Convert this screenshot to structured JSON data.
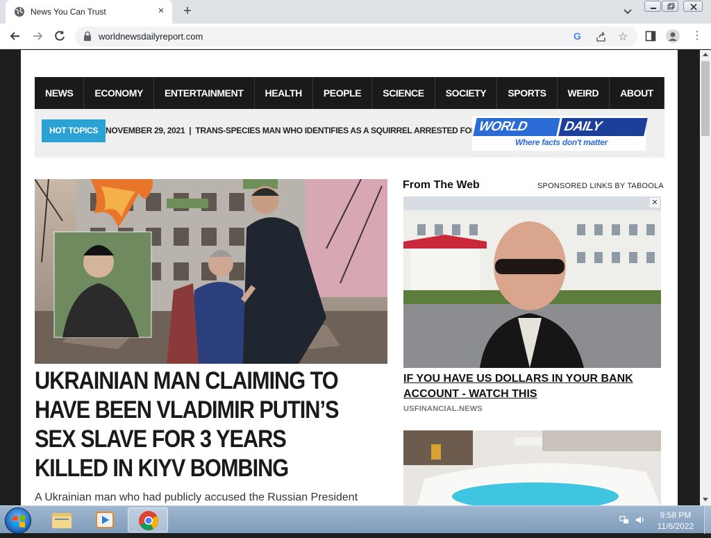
{
  "browser": {
    "tab_title": "News You Can Trust",
    "tab_close": "×",
    "new_tab": "+",
    "url": "worldnewsdailyreport.com",
    "menu_glyph": "⋮",
    "star_glyph": "☆",
    "google_glyph": "G"
  },
  "nav": {
    "items": [
      "NEWS",
      "ECONOMY",
      "ENTERTAINMENT",
      "HEALTH",
      "PEOPLE",
      "SCIENCE",
      "SOCIETY",
      "SPORTS",
      "WEIRD",
      "ABOUT US"
    ]
  },
  "hot_topics": {
    "label": "HOT TOPICS",
    "date": "NOVEMBER 29, 2021",
    "separator": "|",
    "headline": "TRANS-SPECIES MAN WHO IDENTIFIES AS A SQUIRREL ARRESTED FOR"
  },
  "logo": {
    "part1": "WORLD NEWS",
    "part2": "DAILY REPORT",
    "tagline": "Where facts don't matter"
  },
  "article": {
    "headline": "UKRAINIAN MAN CLAIMING TO HAVE BEEN VLADIMIR PUTIN’S SEX SLAVE FOR 3 YEARS KILLED IN KIYV BOMBING",
    "excerpt": "A Ukrainian man who had publicly accused the Russian President"
  },
  "sidebar": {
    "heading": "From The Web",
    "sponsored": "SPONSORED LINKS BY TABOOLA",
    "ad1_title": "IF YOU HAVE US DOLLARS IN YOUR BANK ACCOUNT - WATCH THIS",
    "ad1_source": "USFINANCIAL.NEWS",
    "ad_close": "✕"
  },
  "taskbar": {
    "time": "9:58 PM",
    "date": "11/6/2022"
  },
  "colors": {
    "nav_bg": "#1a1a1a",
    "hot_topics_bg": "#2aa3d4",
    "logo_blue": "#2b6bd6",
    "logo_dark_blue": "#1c3f9a"
  }
}
